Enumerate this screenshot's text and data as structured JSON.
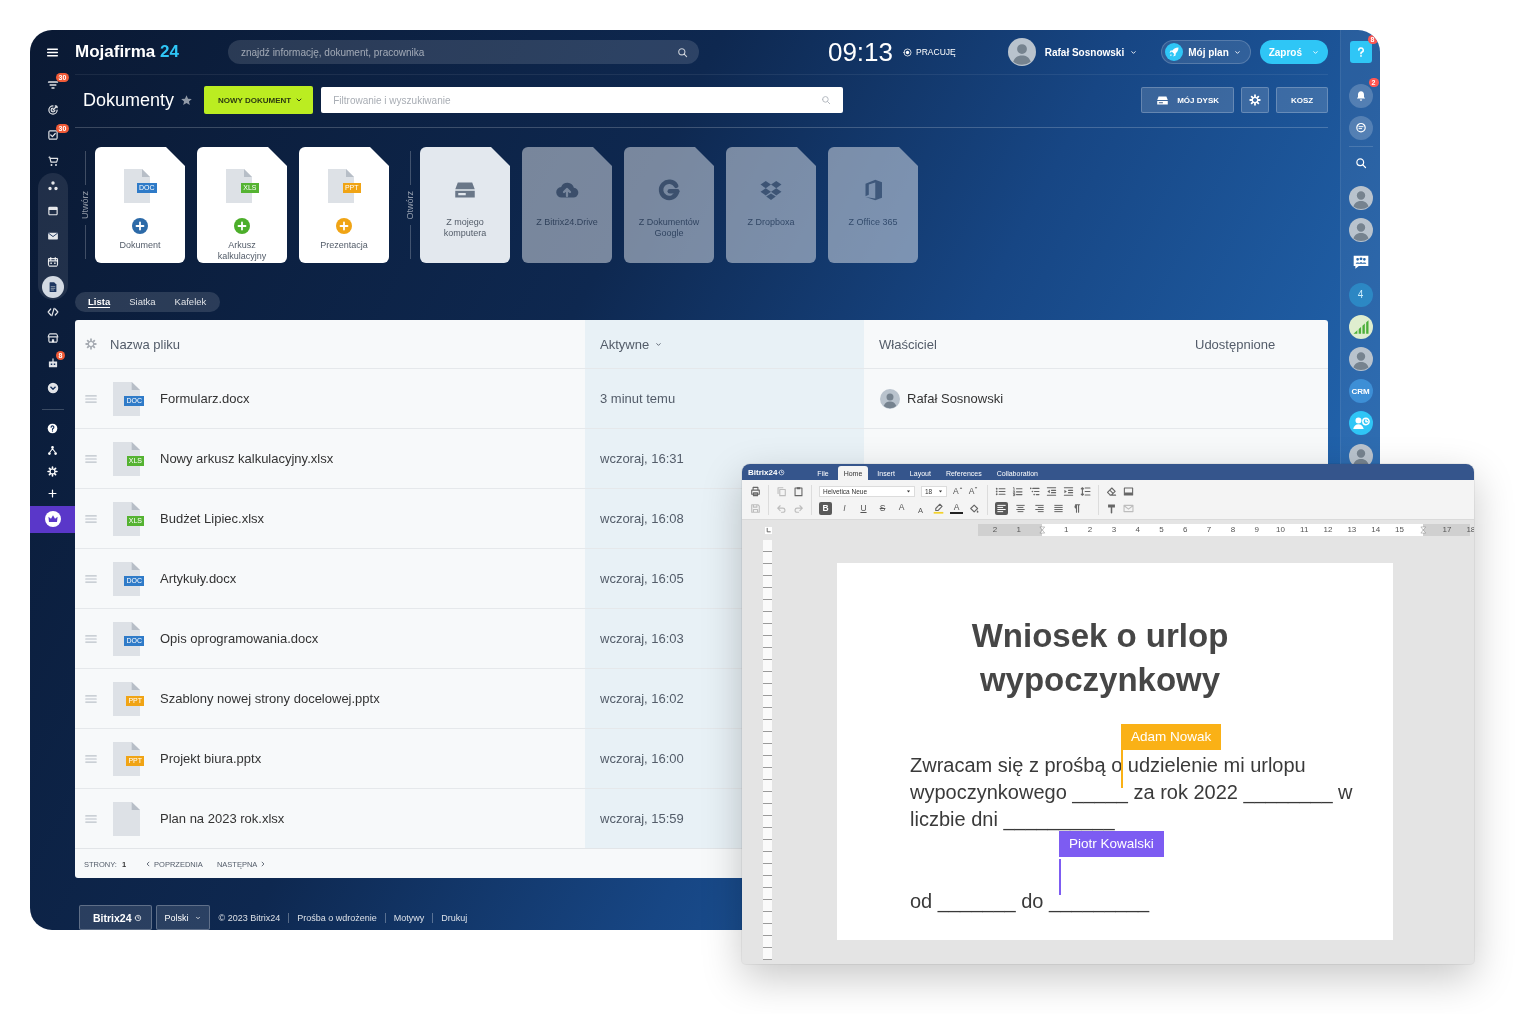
{
  "app": {
    "logo": {
      "name": "Mojafirma",
      "number": "24"
    },
    "search": {
      "placeholder": "znajdź informację, dokument, pracownika"
    },
    "clock": "09:13",
    "work_status": "PRACUJĘ",
    "user": {
      "name": "Rafał Sosnowski"
    },
    "plan_button": "Mój plan",
    "invite_button": "Zaproś"
  },
  "left_sidebar": {
    "items": [
      {
        "badge": "30",
        "selected": false
      },
      {
        "selected": false
      },
      {
        "badge": "30",
        "selected": false
      },
      {
        "selected": false
      },
      {
        "selected": false
      },
      {
        "selected": false
      },
      {
        "selected": false
      },
      {
        "selected": false
      },
      {
        "selected": true
      },
      {
        "selected": false
      },
      {
        "selected": false
      },
      {
        "badge": "8",
        "selected": false
      },
      {
        "selected": false
      }
    ]
  },
  "right_sidebar": {
    "help_badge": "8",
    "notifications_badge": "2",
    "counter": "4",
    "crm_label": "CRM"
  },
  "header": {
    "title": "Dokumenty",
    "new_button": "NOWY DOKUMENT",
    "filter": {
      "placeholder": "Filtrowanie i wyszukiwanie"
    },
    "drive_button": "MÓJ DYSK",
    "trash_button": "KOSZ"
  },
  "create": {
    "label": "Utwórz",
    "tiles": [
      {
        "kind": "doc",
        "badge": "DOC",
        "label": "Dokument"
      },
      {
        "kind": "xls",
        "badge": "XLS",
        "label": "Arkusz kalkulacyjny"
      },
      {
        "kind": "ppt",
        "badge": "PPT",
        "label": "Prezentacja"
      }
    ]
  },
  "open": {
    "label": "Otwórz",
    "tiles": [
      {
        "label": "Z mojego komputera",
        "disabled": false
      },
      {
        "label": "Z Bitrix24.Drive",
        "disabled": true
      },
      {
        "label": "Z Dokumentów Google",
        "disabled": true
      },
      {
        "label": "Z Dropboxa",
        "disabled": true
      },
      {
        "label": "Z Office 365",
        "disabled": true
      }
    ]
  },
  "view_switcher": [
    {
      "label": "Lista",
      "selected": true
    },
    {
      "label": "Siatka",
      "selected": false
    },
    {
      "label": "Kafelek",
      "selected": false
    }
  ],
  "table": {
    "columns": [
      {
        "label": "Nazwa pliku",
        "sorted": false
      },
      {
        "label": "Aktywne",
        "sorted": true
      },
      {
        "label": "Właściciel",
        "sorted": false
      },
      {
        "label": "Udostępnione",
        "sorted": false
      }
    ],
    "rows": [
      {
        "kind": "doc",
        "badge": "DOC",
        "name": "Formularz.docx",
        "activity": "3 minut temu",
        "owner": "Rafał Sosnowski"
      },
      {
        "kind": "xls",
        "badge": "XLS",
        "name": "Nowy arkusz kalkulacyjny.xlsx",
        "activity": "wczoraj, 16:31"
      },
      {
        "kind": "xls",
        "badge": "XLS",
        "name": "Budżet Lipiec.xlsx",
        "activity": "wczoraj, 16:08"
      },
      {
        "kind": "doc",
        "badge": "DOC",
        "name": "Artykuły.docx",
        "activity": "wczoraj, 16:05"
      },
      {
        "kind": "doc",
        "badge": "DOC",
        "name": "Opis oprogramowania.docx",
        "activity": "wczoraj, 16:03"
      },
      {
        "kind": "ppt",
        "badge": "PPT",
        "name": "Szablony nowej strony docelowej.pptx",
        "activity": "wczoraj, 16:02"
      },
      {
        "kind": "ppt",
        "badge": "PPT",
        "name": "Projekt biura.pptx",
        "activity": "wczoraj, 16:00"
      },
      {
        "name": "Plan na 2023 rok.xlsx",
        "activity": "wczoraj, 15:59"
      }
    ]
  },
  "pagination": {
    "label": "STRONY:",
    "page": "1",
    "previous": "POPRZEDNIA",
    "next": "NASTĘPNA"
  },
  "footer": {
    "brand": "Bitrix24",
    "language": "Polski",
    "copyright": "© 2023 Bitrix24",
    "links": [
      "Prośba o wdrożenie",
      "Motywy",
      "Drukuj"
    ]
  },
  "editor": {
    "logo": "Bitrix24",
    "tabs": [
      {
        "label": "File",
        "selected": false
      },
      {
        "label": "Home",
        "selected": true
      },
      {
        "label": "Insert",
        "selected": false
      },
      {
        "label": "Layout",
        "selected": false
      },
      {
        "label": "References",
        "selected": false
      },
      {
        "label": "Collaboration",
        "selected": false
      }
    ],
    "toolbar": {
      "font": "Helvetica Neue",
      "size": "18",
      "size_buttons": [
        {
          "kind": "grow",
          "label": "A"
        },
        {
          "kind": "shrink",
          "label": "A"
        }
      ],
      "format_buttons": [
        {
          "kind": "bold",
          "label": "B",
          "selected": true
        },
        {
          "kind": "italic",
          "label": "I",
          "selected": false
        },
        {
          "kind": "underline",
          "label": "U",
          "selected": false
        },
        {
          "kind": "strike",
          "label": "S",
          "selected": false
        },
        {
          "kind": "superscript",
          "label": "A",
          "selected": false
        },
        {
          "kind": "subscript",
          "label": "A",
          "selected": false
        }
      ],
      "font_color": "A",
      "align_buttons": [
        {
          "selected": true
        },
        {
          "selected": false
        },
        {
          "selected": false
        },
        {
          "selected": false
        }
      ]
    },
    "ruler": [
      "2",
      "1",
      "1",
      "2",
      "3",
      "4",
      "5",
      "6",
      "7",
      "8",
      "9",
      "10",
      "11",
      "12",
      "13",
      "14",
      "15",
      "17",
      "18"
    ],
    "document": {
      "title": "Wniosek o urlop wypoczynkowy",
      "paragraphs": [
        {
          "segments": [
            {
              "kind": "text",
              "text": "Zwracam się z prośbą o"
            },
            {
              "kind": "cursor",
              "name": "Adam Nowak",
              "color": "#fab116"
            },
            {
              "kind": "text",
              "text": " udzielenie mi urlopu wypoczynkowego _____ za rok 2022 ________ w liczbie dni __________"
            }
          ]
        },
        {
          "segments": [
            {
              "kind": "text",
              "text": "od _______ do _"
            },
            {
              "kind": "cursor",
              "name": "Piotr Kowalski",
              "color": "#7d5cf2"
            },
            {
              "kind": "text",
              "text": "________"
            }
          ]
        }
      ]
    }
  }
}
